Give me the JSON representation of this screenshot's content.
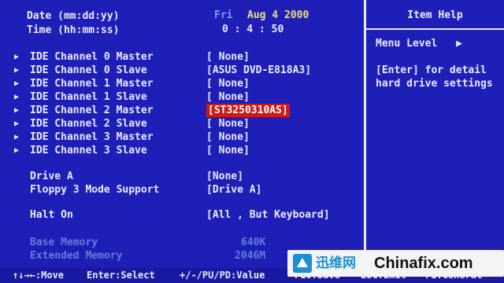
{
  "datetime": {
    "date_label": "Date (mm:dd:yy)",
    "time_label": "Time (hh:mm:ss)",
    "date_day": "Fri",
    "date_value": "Aug  4 2000",
    "time_value": "0 :  4 : 50"
  },
  "ide_channels": [
    {
      "label": "IDE Channel 0 Master",
      "value": "[ None]"
    },
    {
      "label": "IDE Channel 0 Slave",
      "value": "[ASUS    DVD-E818A3]"
    },
    {
      "label": "IDE Channel 1 Master",
      "value": "[ None]"
    },
    {
      "label": "IDE Channel 1 Slave",
      "value": "[ None]"
    },
    {
      "label": "IDE Channel 2 Master",
      "value": "[ST3250310AS]"
    },
    {
      "label": "IDE Channel 2 Slave",
      "value": "[ None]"
    },
    {
      "label": "IDE Channel 3 Master",
      "value": "[ None]"
    },
    {
      "label": "IDE Channel 3 Slave",
      "value": "[ None]"
    }
  ],
  "drive": {
    "drive_a_label": "Drive A",
    "drive_a_value": "[None]",
    "floppy3_label": "Floppy 3 Mode Support",
    "floppy3_value": "[Drive A]"
  },
  "halt": {
    "label": "Halt On",
    "value": "[All , But Keyboard]"
  },
  "memory": {
    "base_label": "Base Memory",
    "base_value": "640K",
    "ext_label": "Extended Memory",
    "ext_value": "2046M"
  },
  "help": {
    "title": "Item Help",
    "menu_level": "Menu Level",
    "menu_arrow": "▶",
    "line1": "[Enter] for detail",
    "line2": "hard drive settings"
  },
  "footer": {
    "move": "↑↓→←:Move",
    "select": "Enter:Select",
    "value": "+/-/PU/PD:Value",
    "save": "F10:Save",
    "exit": "ESC:Exit",
    "general": "F1:General"
  },
  "watermark": {
    "cn": "迅维网",
    "en": "Chinafix.com"
  },
  "colors": {
    "background": "#1f1fb8",
    "text": "#e8ecff",
    "highlight": "#d01818",
    "date_value": "#f0e070",
    "dim": "#5f7fd6"
  }
}
